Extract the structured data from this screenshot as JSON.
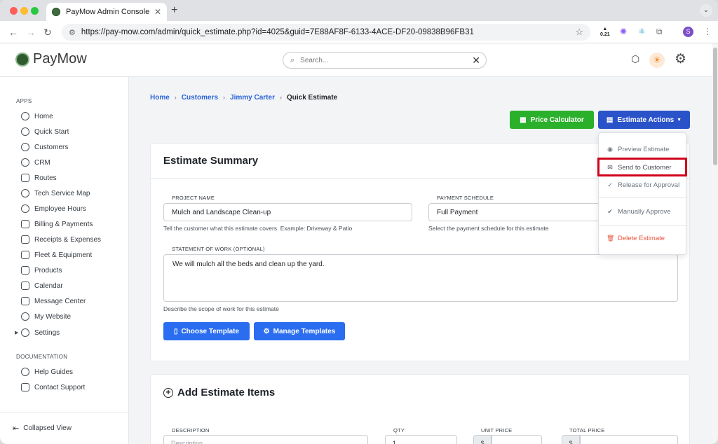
{
  "browser": {
    "tab_title": "PayMow Admin Console",
    "url": "https://pay-mow.com/admin/quick_estimate.php?id=4025&guid=7E88AF8F-6133-4ACE-DF20-09838B96FB31",
    "ext_badge": "0.21",
    "profile_initial": "S"
  },
  "app": {
    "logo_text": "PayMow",
    "search_placeholder": "Search..."
  },
  "sidebar": {
    "apps_heading": "APPS",
    "items": [
      {
        "label": "Home"
      },
      {
        "label": "Quick Start"
      },
      {
        "label": "Customers"
      },
      {
        "label": "CRM"
      },
      {
        "label": "Routes"
      },
      {
        "label": "Tech Service Map"
      },
      {
        "label": "Employee Hours"
      },
      {
        "label": "Billing & Payments"
      },
      {
        "label": "Receipts & Expenses"
      },
      {
        "label": "Fleet & Equipment"
      },
      {
        "label": "Products"
      },
      {
        "label": "Calendar"
      },
      {
        "label": "Message Center"
      },
      {
        "label": "My Website"
      },
      {
        "label": "Settings"
      }
    ],
    "docs_heading": "DOCUMENTATION",
    "doc_items": [
      {
        "label": "Help Guides"
      },
      {
        "label": "Contact Support"
      }
    ],
    "collapse_label": "Collapsed View"
  },
  "breadcrumb": [
    "Home",
    "Customers",
    "Jimmy Carter",
    "Quick Estimate"
  ],
  "actions": {
    "price_calculator": "Price Calculator",
    "estimate_actions": "Estimate Actions"
  },
  "dropdown": {
    "items": [
      {
        "label": "Preview Estimate"
      },
      {
        "label": "Send to Customer"
      },
      {
        "label": "Release for Approval"
      },
      {
        "label": "Manually Approve"
      },
      {
        "label": "Delete Estimate"
      }
    ]
  },
  "summary": {
    "title": "Estimate Summary",
    "project_name_label": "PROJECT NAME",
    "project_name_value": "Mulch and Landscape Clean-up",
    "project_name_hint": "Tell the customer what this estimate covers. Example: Driveway & Patio",
    "payment_label": "PAYMENT SCHEDULE",
    "payment_value": "Full Payment",
    "payment_hint": "Select the payment schedule for this estimate",
    "sow_label": "STATEMENT OF WORK (OPTIONAL)",
    "sow_value": "We will mulch all the beds and clean up the yard.",
    "sow_hint": "Describe the scope of work for this estimate",
    "choose_template": "Choose Template",
    "manage_templates": "Manage Templates"
  },
  "items": {
    "title": "Add Estimate Items",
    "description_label": "DESCRIPTION",
    "description_placeholder": "Description",
    "qty_label": "QTY",
    "qty_value": "1",
    "unit_price_label": "UNIT PRICE",
    "total_price_label": "TOTAL PRICE",
    "currency": "$"
  }
}
